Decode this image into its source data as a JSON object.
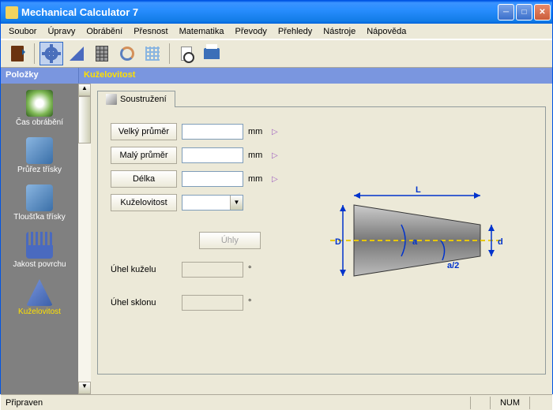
{
  "window": {
    "title": "Mechanical Calculator 7"
  },
  "menu": [
    "Soubor",
    "Úpravy",
    "Obrábění",
    "Přesnost",
    "Matematika",
    "Převody",
    "Přehledy",
    "Nástroje",
    "Nápověda"
  ],
  "sideheader": {
    "left": "Položky",
    "right": "Kuželovitost"
  },
  "sidebar": [
    {
      "label": "Čas obrábění",
      "color": "#7FB855"
    },
    {
      "label": "Průřez třísky",
      "color": "#5A8CC5"
    },
    {
      "label": "Tloušťka třísky",
      "color": "#5A8CC5"
    },
    {
      "label": "Jakost povrchu",
      "color": "#4A6ABF"
    },
    {
      "label": "Kuželovitost",
      "color": "#4A6ABF"
    }
  ],
  "tab": {
    "label": "Soustružení"
  },
  "form": {
    "rows": [
      {
        "btn": "Velký průměr",
        "value": "",
        "unit": "mm"
      },
      {
        "btn": "Malý průměr",
        "value": "",
        "unit": "mm"
      },
      {
        "btn": "Délka",
        "value": "",
        "unit": "mm"
      }
    ],
    "combo_label": "Kuželovitost",
    "angle_btn": "Úhly",
    "out1_label": "Úhel kuželu",
    "out2_label": "Úhel sklonu",
    "deg": "°"
  },
  "diagram": {
    "L": "L",
    "D": "D",
    "d": "d",
    "a": "a",
    "a2": "a/2"
  },
  "status": {
    "left": "Připraven",
    "right": "NUM"
  }
}
